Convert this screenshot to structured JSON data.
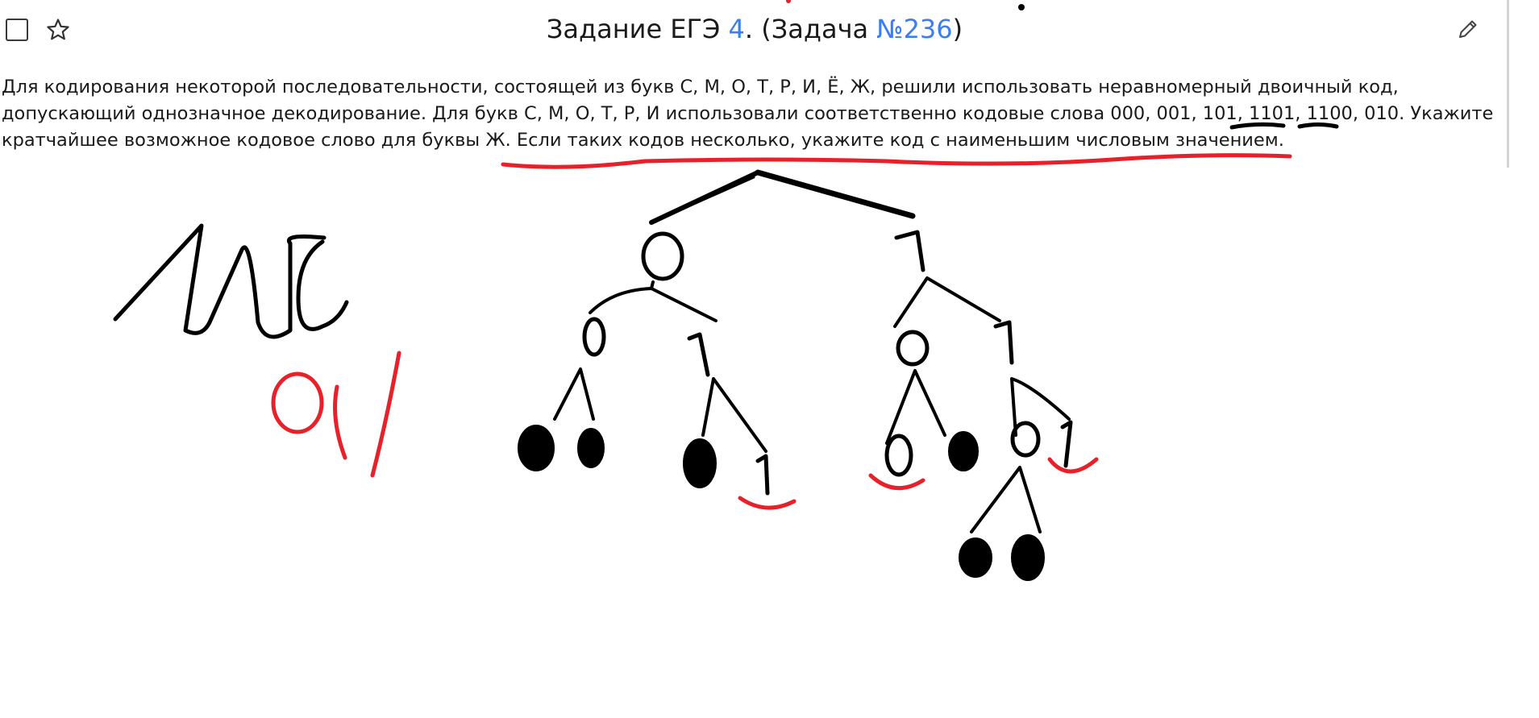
{
  "header": {
    "title_prefix": "Задание ЕГЭ ",
    "task_number": "4",
    "title_middle": ". (Задача ",
    "problem_id": "№236",
    "title_suffix": ")"
  },
  "problem": {
    "line1": "Для кодирования некоторой последовательности, состоящей из букв С, М, О, Т, Р, И, Ё, Ж, решили использовать неравномерный двоичный код,",
    "line2": "допускающий однозначное декодирование. Для букв С, М, О, Т, Р, И использовали соответственно кодовые слова 000, 001, 101, 1101, 1100, 010. Укажите",
    "line3": "кратчайшее возможное кодовое слово для буквы Ж. Если таких кодов несколько, укажите код с наименьшим числовым значением."
  },
  "icons": {
    "checkbox": "checkbox-icon",
    "favorite": "star-icon",
    "edit": "pencil-icon"
  },
  "annotations": {
    "ink_colors": {
      "black": "#000000",
      "red": "#e8202a"
    }
  },
  "colors": {
    "link": "#3a7ef0",
    "text": "#1a1a1a"
  }
}
